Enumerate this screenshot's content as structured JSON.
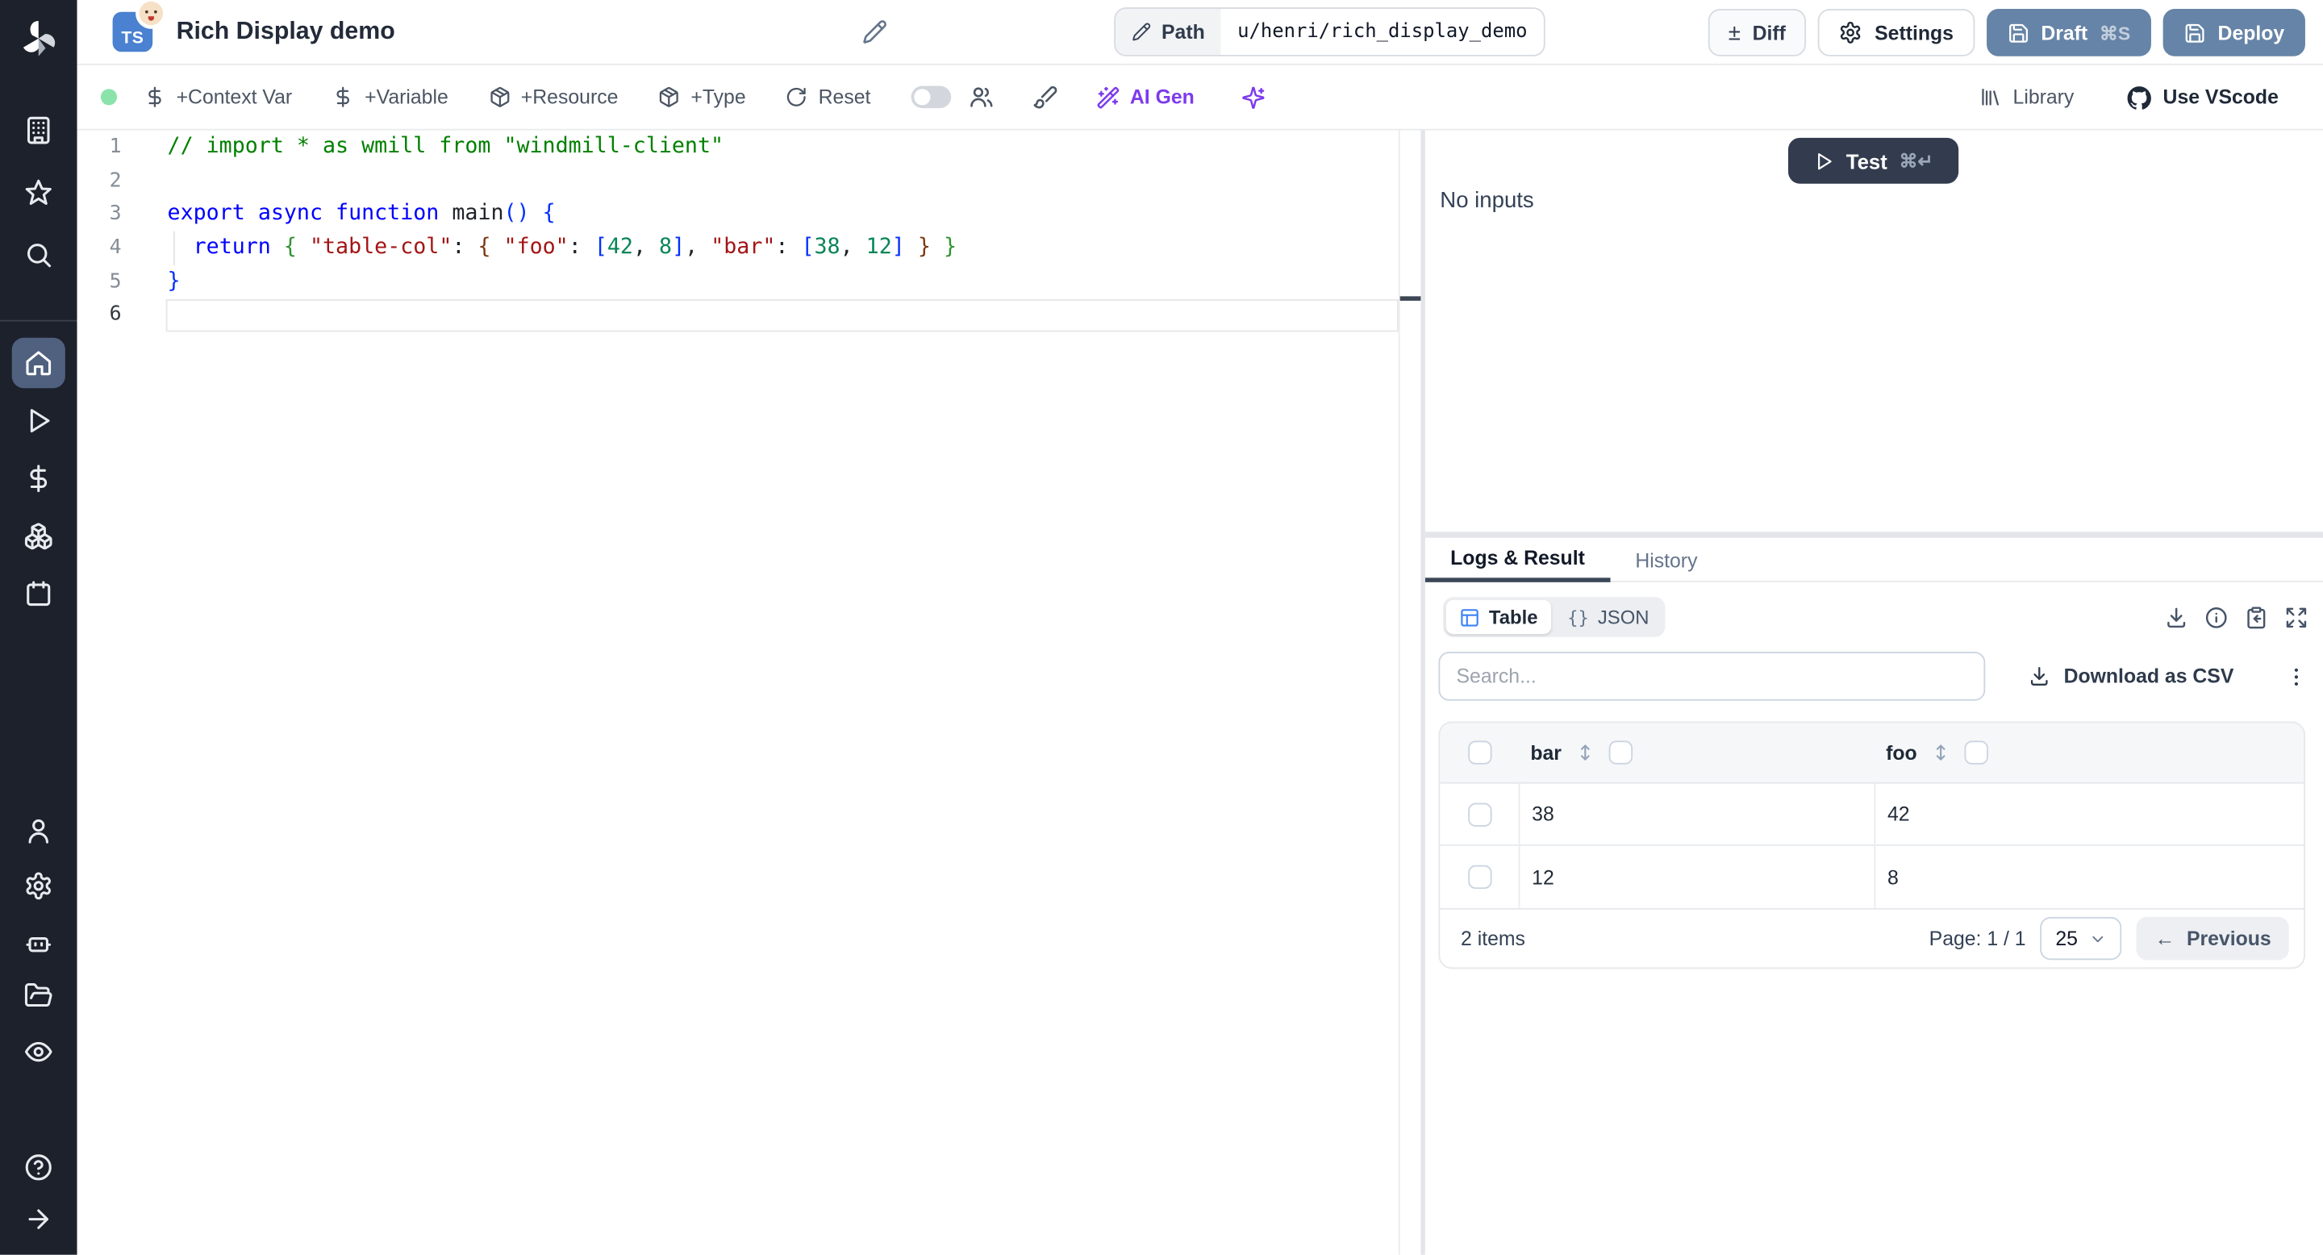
{
  "colors": {
    "status_green": "#8be3ac",
    "ai_purple": "#7c3aed",
    "deploy_slate_blue": "#6684a7",
    "test_navy": "#333c4f",
    "sidebar_active": "#50617f",
    "table_icon_blue": "#3b82f6",
    "ts_badge_blue": "#4a81d0"
  },
  "sidebar": {
    "items": [
      {
        "icon": "building"
      },
      {
        "icon": "star"
      },
      {
        "icon": "search"
      },
      {
        "icon": "home",
        "active": true
      },
      {
        "icon": "play"
      },
      {
        "icon": "dollar"
      },
      {
        "icon": "boxes"
      },
      {
        "icon": "calendar"
      },
      {
        "icon": "user"
      },
      {
        "icon": "settings"
      },
      {
        "icon": "bot"
      },
      {
        "icon": "folder-open"
      },
      {
        "icon": "eye"
      },
      {
        "icon": "help"
      },
      {
        "icon": "arrow-right"
      }
    ]
  },
  "header": {
    "lang_badge": "TS",
    "title": "Rich Display demo",
    "path_label": "Path",
    "path_value": "u/henri/rich_display_demo",
    "diff_label": "Diff",
    "settings_label": "Settings",
    "draft_label": "Draft",
    "draft_shortcut": "⌘S",
    "deploy_label": "Deploy"
  },
  "toolbar": {
    "actions": [
      {
        "icon": "dollar",
        "label": "+Context Var"
      },
      {
        "icon": "dollar",
        "label": "+Variable"
      },
      {
        "icon": "package",
        "label": "+Resource"
      },
      {
        "icon": "package",
        "label": "+Type"
      },
      {
        "icon": "refresh",
        "label": "Reset"
      }
    ],
    "ai_gen_label": "AI Gen",
    "library_label": "Library",
    "vscode_label": "Use VScode"
  },
  "editor": {
    "active_line": 6,
    "lines": [
      {
        "tokens": [
          {
            "t": "// import * as wmill from \"windmill-client\"",
            "c": "cmt"
          }
        ]
      },
      {
        "tokens": []
      },
      {
        "tokens": [
          {
            "t": "export",
            "c": "kw"
          },
          {
            "t": " ",
            "c": "pl"
          },
          {
            "t": "async",
            "c": "kw"
          },
          {
            "t": " ",
            "c": "pl"
          },
          {
            "t": "function",
            "c": "kw"
          },
          {
            "t": " ",
            "c": "pl"
          },
          {
            "t": "main",
            "c": "fn"
          },
          {
            "t": "(",
            "c": "b1"
          },
          {
            "t": ")",
            "c": "b1"
          },
          {
            "t": " ",
            "c": "pl"
          },
          {
            "t": "{",
            "c": "b1"
          }
        ]
      },
      {
        "tokens": [
          {
            "t": "  ",
            "c": "pl"
          },
          {
            "t": "return",
            "c": "kw"
          },
          {
            "t": " ",
            "c": "pl"
          },
          {
            "t": "{",
            "c": "b2"
          },
          {
            "t": " ",
            "c": "pl"
          },
          {
            "t": "\"table-col\"",
            "c": "str"
          },
          {
            "t": ":",
            "c": "pl"
          },
          {
            "t": " ",
            "c": "pl"
          },
          {
            "t": "{",
            "c": "b3"
          },
          {
            "t": " ",
            "c": "pl"
          },
          {
            "t": "\"foo\"",
            "c": "str"
          },
          {
            "t": ":",
            "c": "pl"
          },
          {
            "t": " ",
            "c": "pl"
          },
          {
            "t": "[",
            "c": "b1"
          },
          {
            "t": "42",
            "c": "num"
          },
          {
            "t": ",",
            "c": "pl"
          },
          {
            "t": " ",
            "c": "pl"
          },
          {
            "t": "8",
            "c": "num"
          },
          {
            "t": "]",
            "c": "b1"
          },
          {
            "t": ",",
            "c": "pl"
          },
          {
            "t": " ",
            "c": "pl"
          },
          {
            "t": "\"bar\"",
            "c": "str"
          },
          {
            "t": ":",
            "c": "pl"
          },
          {
            "t": " ",
            "c": "pl"
          },
          {
            "t": "[",
            "c": "b1"
          },
          {
            "t": "38",
            "c": "num"
          },
          {
            "t": ",",
            "c": "pl"
          },
          {
            "t": " ",
            "c": "pl"
          },
          {
            "t": "12",
            "c": "num"
          },
          {
            "t": "]",
            "c": "b1"
          },
          {
            "t": " ",
            "c": "pl"
          },
          {
            "t": "}",
            "c": "b3"
          },
          {
            "t": " ",
            "c": "pl"
          },
          {
            "t": "}",
            "c": "b2"
          }
        ]
      },
      {
        "tokens": [
          {
            "t": "}",
            "c": "b1"
          }
        ]
      },
      {
        "tokens": []
      }
    ]
  },
  "run_panel": {
    "test_label": "Test",
    "test_shortcut": "⌘↵",
    "no_inputs": "No inputs"
  },
  "result_panel": {
    "tabs": [
      {
        "label": "Logs & Result",
        "active": true
      },
      {
        "label": "History",
        "active": false
      }
    ],
    "view_toggle": [
      {
        "icon": "table",
        "label": "Table",
        "active": true
      },
      {
        "icon": "braces",
        "label": "JSON",
        "active": false
      }
    ],
    "corner_icons": [
      "download",
      "info",
      "clipboard-copy",
      "expand"
    ],
    "search_placeholder": "Search...",
    "download_csv_label": "Download as CSV",
    "table": {
      "columns": [
        "bar",
        "foo"
      ],
      "rows": [
        [
          "38",
          "42"
        ],
        [
          "12",
          "8"
        ]
      ]
    },
    "footer": {
      "count_label": "2 items",
      "page_label": "Page: 1 / 1",
      "page_size": "25",
      "previous_label": "Previous"
    }
  }
}
